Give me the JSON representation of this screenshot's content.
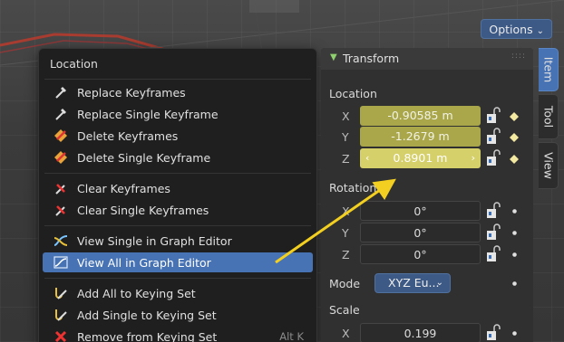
{
  "header": {
    "options_label": "Options"
  },
  "menu": {
    "title": "Location",
    "items": [
      {
        "label": "Replace Keyframes",
        "icon": "keyframe-add-icon",
        "shortcut": ""
      },
      {
        "label": "Replace Single Keyframe",
        "icon": "keyframe-add-icon",
        "shortcut": ""
      },
      {
        "label": "Delete Keyframes",
        "icon": "keyframe-delete-icon",
        "shortcut": ""
      },
      {
        "label": "Delete Single Keyframe",
        "icon": "keyframe-delete-icon",
        "shortcut": ""
      },
      {
        "label": "Clear Keyframes",
        "icon": "keyframe-clear-icon",
        "shortcut": ""
      },
      {
        "label": "Clear Single Keyframes",
        "icon": "keyframe-clear-icon",
        "shortcut": ""
      },
      {
        "label": "View Single in Graph Editor",
        "icon": "graph-editor-icon",
        "shortcut": ""
      },
      {
        "label": "View All in Graph Editor",
        "icon": "graph-editor-icon",
        "shortcut": ""
      },
      {
        "label": "Add All to Keying Set",
        "icon": "keying-set-add-icon",
        "shortcut": ""
      },
      {
        "label": "Add Single to Keying Set",
        "icon": "keying-set-add-icon",
        "shortcut": ""
      },
      {
        "label": "Remove from Keying Set",
        "icon": "remove-x-icon",
        "shortcut": "Alt K"
      }
    ],
    "active_index": 7
  },
  "panel": {
    "header": "Transform",
    "location_label": "Location",
    "location": [
      {
        "axis": "X",
        "value": "-0.90585 m"
      },
      {
        "axis": "Y",
        "value": "-1.2679 m"
      },
      {
        "axis": "Z",
        "value": "0.8901 m"
      }
    ],
    "rotation_label": "Rotation",
    "rotation": [
      {
        "axis": "X",
        "value": "0°"
      },
      {
        "axis": "Y",
        "value": "0°"
      },
      {
        "axis": "Z",
        "value": "0°"
      }
    ],
    "mode_label": "Mode",
    "mode_value": "XYZ Eu...",
    "scale_label": "Scale",
    "scale": [
      {
        "axis": "X",
        "value": "0.199"
      }
    ]
  },
  "tabs": [
    "Item",
    "Tool",
    "View"
  ],
  "colors": {
    "keyframed": "#a9a74a",
    "accent": "#4772b3",
    "annotation_arrow": "#f2cf20"
  }
}
